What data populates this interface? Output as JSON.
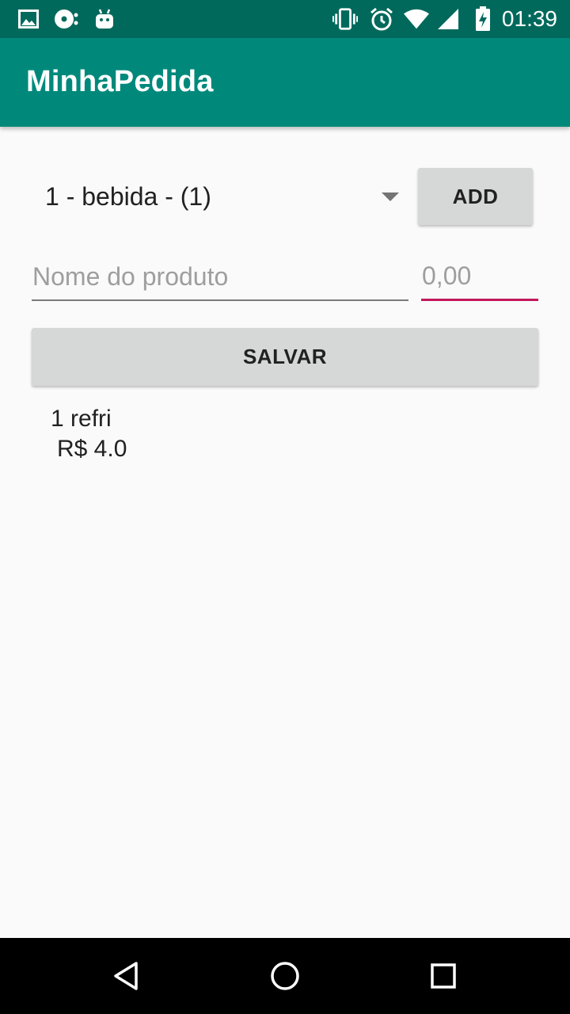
{
  "status_bar": {
    "time": "01:39",
    "left_icons": [
      "gallery-icon",
      "disc-icon",
      "android-icon"
    ],
    "right_icons": [
      "vibrate-icon",
      "alarm-icon",
      "wifi-icon",
      "signal-icon",
      "battery-charging-icon"
    ]
  },
  "app_bar": {
    "title": "MinhaPedida"
  },
  "spinner": {
    "selected": "1 - bebida - (1)"
  },
  "buttons": {
    "add": "ADD",
    "save": "SALVAR"
  },
  "fields": {
    "name": {
      "placeholder": "Nome do produto",
      "value": ""
    },
    "price": {
      "placeholder": "0,00",
      "value": ""
    }
  },
  "items": [
    {
      "name": "1 refri",
      "price": "R$ 4.0"
    }
  ],
  "colors": {
    "status_bar": "#00695c",
    "app_bar": "#00897b",
    "accent": "#c2185b",
    "button": "#d6d7d7"
  },
  "nav_bar": {
    "icons": [
      "back-icon",
      "home-icon",
      "recents-icon"
    ]
  }
}
